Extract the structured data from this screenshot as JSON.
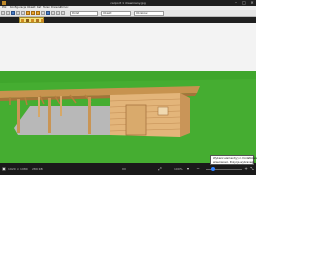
{
  "window": {
    "title": "carport 1 drewniany.jpg",
    "minimize_glyph": "–",
    "maximize_glyph": "□",
    "close_glyph": "✕"
  },
  "menu": {
    "items": [
      "Plik",
      "Konfiguracja",
      "Obiekt",
      "Kat",
      "Teren",
      "Drewno",
      "Pomoc"
    ]
  },
  "toolbar": {
    "field1": "Podst",
    "field2": "Obiekt",
    "field3": "Obrakow"
  },
  "status": {
    "left_text": "1920 × 1080",
    "file_size": "289 KB",
    "zoom": "100%",
    "zoom_fill": 0.15
  },
  "tooltip": {
    "line1": "Wybierz element(y) z. Dodatkowe",
    "line2": "wlasciwosci. Pozycja wybranego"
  },
  "colors": {
    "window_bg": "#1f1f1f",
    "sky": "#f2f2f2",
    "grass": "#3fa62c",
    "timber": "#d9a86a",
    "accent": "#2f7fff"
  }
}
